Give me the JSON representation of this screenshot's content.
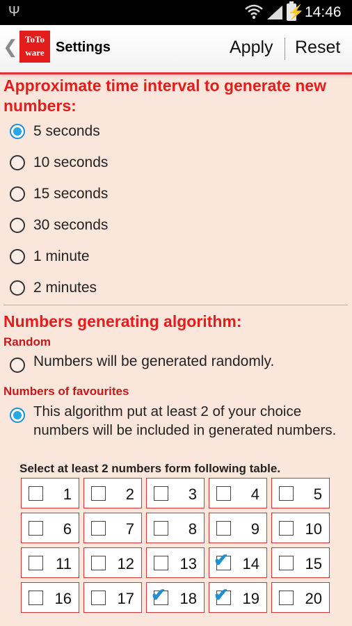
{
  "status_bar": {
    "time": "14:46",
    "icons": [
      "usb-icon",
      "wifi-icon",
      "signal-icon",
      "battery-icon"
    ]
  },
  "action_bar": {
    "logo_line1": "ToTo",
    "logo_line2": "ware",
    "title": "Settings",
    "apply_label": "Apply",
    "reset_label": "Reset"
  },
  "interval": {
    "title": "Approximate time interval to generate new numbers:",
    "options": [
      "5 seconds",
      "10 seconds",
      "15 seconds",
      "30 seconds",
      "1 minute",
      "2 minutes"
    ],
    "selected": "5 seconds"
  },
  "algorithm": {
    "title": "Numbers generating algorithm:",
    "random_title": "Random",
    "random_desc": "Numbers will be generated randomly.",
    "fav_title": "Numbers of favourites",
    "fav_desc": "This algorithm put at least 2 of your choice numbers will be included in generated numbers.",
    "selected": "favourites"
  },
  "table": {
    "caption": "Select at least 2 numbers form following table.",
    "numbers": [
      "1",
      "2",
      "3",
      "4",
      "5",
      "6",
      "7",
      "8",
      "9",
      "10",
      "11",
      "12",
      "13",
      "14",
      "15",
      "16",
      "17",
      "18",
      "19",
      "20"
    ],
    "checked": [
      "14",
      "18",
      "19"
    ]
  },
  "colors": {
    "accent_red": "#e51c1c",
    "radio_blue": "#2aa7e8",
    "background": "#fbe6db"
  }
}
